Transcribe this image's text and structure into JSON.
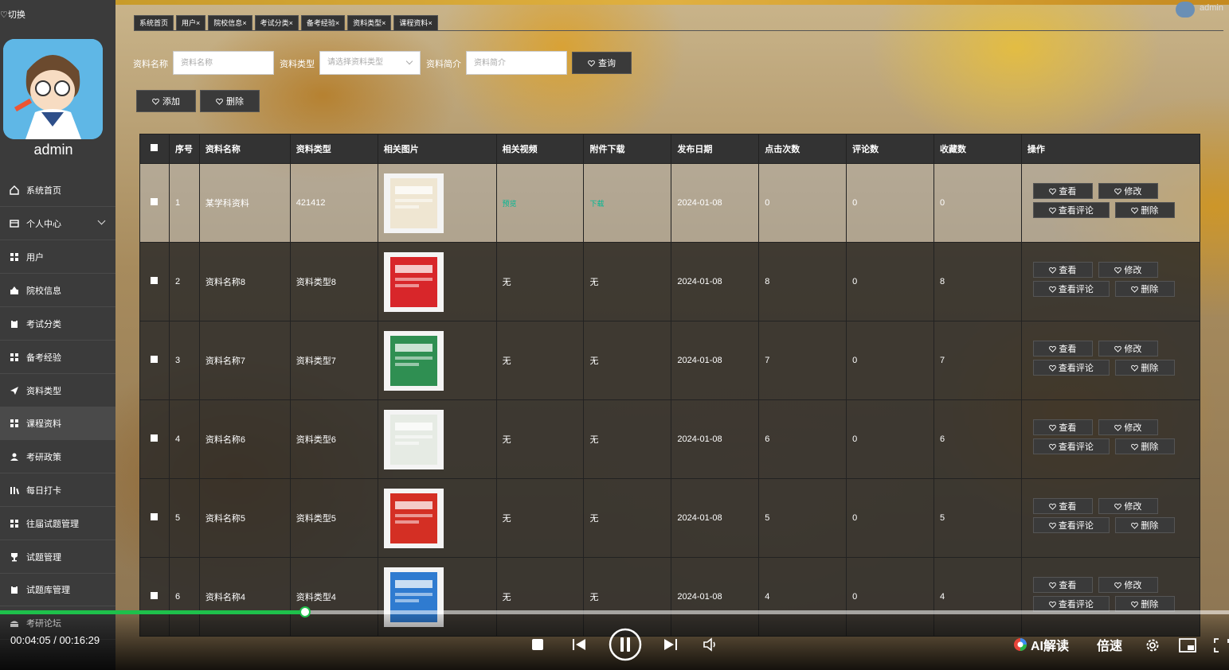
{
  "sidebar": {
    "toggle_label": "切换",
    "username": "admin",
    "items": [
      {
        "label": "系统首页",
        "icon": "home-icon"
      },
      {
        "label": "个人中心",
        "icon": "panel-icon"
      },
      {
        "label": "用户",
        "icon": "grid-icon"
      },
      {
        "label": "院校信息",
        "icon": "school-icon"
      },
      {
        "label": "考试分类",
        "icon": "clipboard-icon"
      },
      {
        "label": "备考经验",
        "icon": "grid-icon"
      },
      {
        "label": "资料类型",
        "icon": "send-icon"
      },
      {
        "label": "课程资料",
        "icon": "grid-icon"
      },
      {
        "label": "考研政策",
        "icon": "user-icon"
      },
      {
        "label": "每日打卡",
        "icon": "bars-icon"
      },
      {
        "label": "往届试题管理",
        "icon": "grid-icon"
      },
      {
        "label": "试题管理",
        "icon": "trophy-icon"
      },
      {
        "label": "试题库管理",
        "icon": "clipboard-icon"
      },
      {
        "label": "考研论坛",
        "icon": "forum-icon"
      }
    ]
  },
  "header": {
    "user": "admin",
    "tabs": [
      "系统首页",
      "用户",
      "院校信息",
      "考试分类",
      "备考经验",
      "资料类型",
      "课程资料"
    ]
  },
  "search": {
    "name_label": "资料名称",
    "name_placeholder": "资料名称",
    "type_label": "资料类型",
    "type_placeholder": "请选择资料类型",
    "intro_label": "资料简介",
    "intro_placeholder": "资料简介",
    "query_button": "查询",
    "add_button": "添加",
    "delete_button": "删除"
  },
  "table": {
    "headers": [
      "序号",
      "资料名称",
      "资料类型",
      "相关图片",
      "相关视频",
      "附件下载",
      "发布日期",
      "点击次数",
      "评论数",
      "收藏数",
      "操作"
    ],
    "actions": {
      "view": "查看",
      "edit": "修改",
      "comments": "查看评论",
      "delete": "删除"
    },
    "rows": [
      {
        "no": "1",
        "name": "某学科资料",
        "type": "421412",
        "video": "预览",
        "attachment": "下载",
        "date": "2024-01-08",
        "clicks": "0",
        "comments": "0",
        "favorites": "0",
        "img_color": "#efe6d2"
      },
      {
        "no": "2",
        "name": "资料名称8",
        "type": "资料类型8",
        "video": "无",
        "attachment": "无",
        "date": "2024-01-08",
        "clicks": "8",
        "comments": "0",
        "favorites": "8",
        "img_color": "#d8262a"
      },
      {
        "no": "3",
        "name": "资料名称7",
        "type": "资料类型7",
        "video": "无",
        "attachment": "无",
        "date": "2024-01-08",
        "clicks": "7",
        "comments": "0",
        "favorites": "7",
        "img_color": "#2f8f52"
      },
      {
        "no": "4",
        "name": "资料名称6",
        "type": "资料类型6",
        "video": "无",
        "attachment": "无",
        "date": "2024-01-08",
        "clicks": "6",
        "comments": "0",
        "favorites": "6",
        "img_color": "#e6ebe4"
      },
      {
        "no": "5",
        "name": "资料名称5",
        "type": "资料类型5",
        "video": "无",
        "attachment": "无",
        "date": "2024-01-08",
        "clicks": "5",
        "comments": "0",
        "favorites": "5",
        "img_color": "#d42f24"
      },
      {
        "no": "6",
        "name": "资料名称4",
        "type": "资料类型4",
        "video": "无",
        "attachment": "无",
        "date": "2024-01-08",
        "clicks": "4",
        "comments": "0",
        "favorites": "4",
        "img_color": "#2f7bd0"
      }
    ]
  },
  "player": {
    "time": "00:04:05 / 00:16:29",
    "progress": 0.248,
    "ai_label": "AI解读",
    "speed_label": "倍速",
    "accent": "#1ec04b"
  }
}
